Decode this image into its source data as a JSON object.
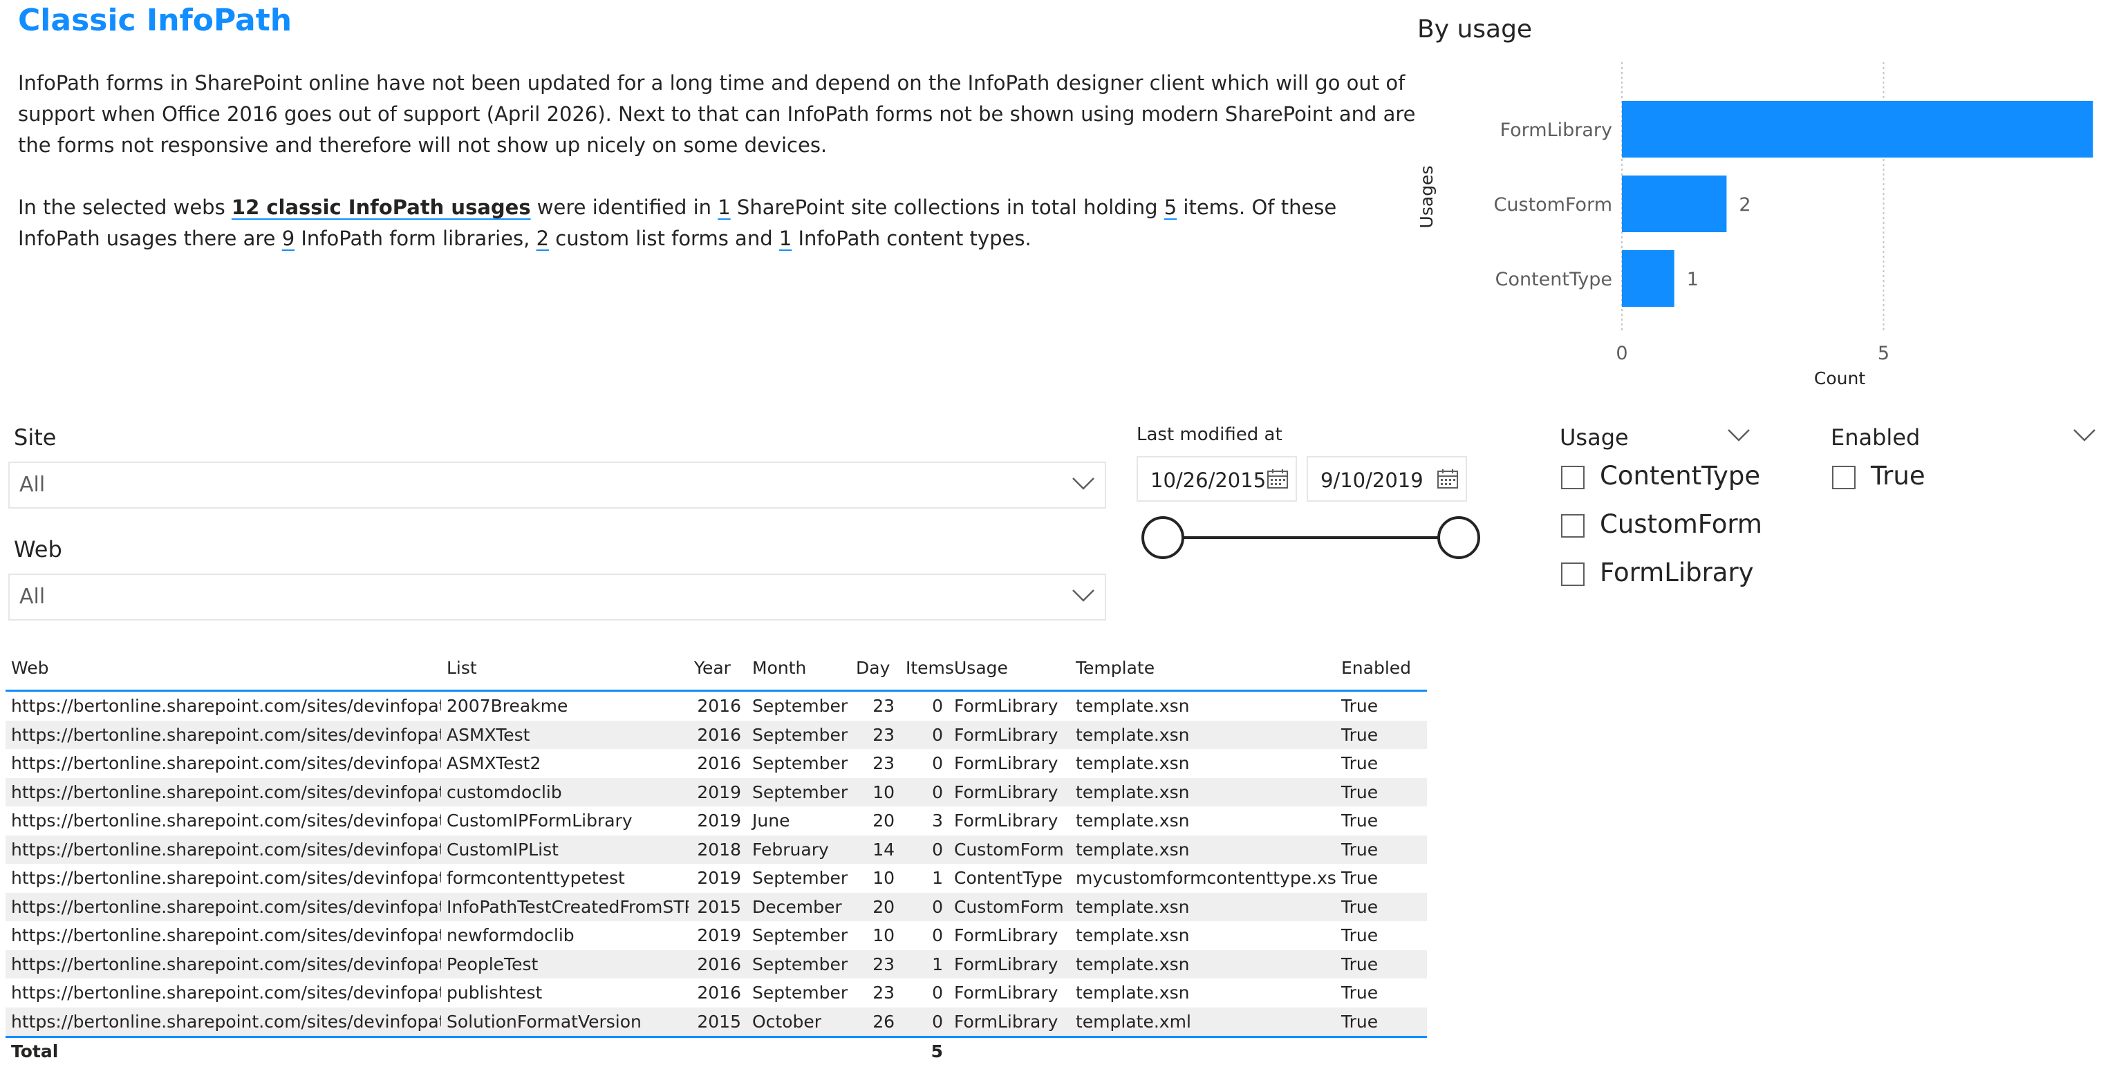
{
  "header": {
    "title": "Classic InfoPath"
  },
  "intro": {
    "paragraph1": "InfoPath forms in SharePoint online have not been updated for a long time and depend on the InfoPath designer client which will go out of support when Office 2016 goes out of support (April 2026). Next to that can InfoPath forms not be shown using modern SharePoint and are the forms not responsive and therefore will not show up nicely on some devices.",
    "p2_a": "In the selected webs ",
    "p2_usages": "12 classic InfoPath usages",
    "p2_b": " were identified in ",
    "p2_sites": "1",
    "p2_c": " SharePoint site collections in total holding ",
    "p2_items": "5",
    "p2_d": " items. Of these InfoPath usages there are ",
    "p2_forms": "9",
    "p2_e": " InfoPath form libraries, ",
    "p2_custom": "2",
    "p2_f": " custom list forms and ",
    "p2_ct": "1",
    "p2_g": " InfoPath content types."
  },
  "chart_data": {
    "type": "bar",
    "orientation": "horizontal",
    "title": "By usage",
    "xlabel": "Count",
    "ylabel": "Usages",
    "categories": [
      "FormLibrary",
      "CustomForm",
      "ContentType"
    ],
    "values": [
      9,
      2,
      1
    ],
    "xlim": [
      0,
      10
    ],
    "xticks": [
      0,
      5,
      10
    ],
    "bar_color": "#118DFF",
    "grid": true
  },
  "filters": {
    "site_label": "Site",
    "site_value": "All",
    "web_label": "Web",
    "web_value": "All",
    "date_label": "Last modified at",
    "date_start": "10/26/2015",
    "date_end": "9/10/2019",
    "usage_label": "Usage",
    "usage_options": [
      "ContentType",
      "CustomForm",
      "FormLibrary"
    ],
    "enabled_label": "Enabled",
    "enabled_options": [
      "True"
    ]
  },
  "table": {
    "columns": [
      "Web",
      "List",
      "Year",
      "Month",
      "Day",
      "Items",
      "Usage",
      "Template",
      "Enabled"
    ],
    "rows": [
      [
        "https://bertonline.sharepoint.com/sites/devinfopath/",
        "2007Breakme",
        "2016",
        "September",
        "23",
        "0",
        "FormLibrary",
        "template.xsn",
        "True"
      ],
      [
        "https://bertonline.sharepoint.com/sites/devinfopath/",
        "ASMXTest",
        "2016",
        "September",
        "23",
        "0",
        "FormLibrary",
        "template.xsn",
        "True"
      ],
      [
        "https://bertonline.sharepoint.com/sites/devinfopath/",
        "ASMXTest2",
        "2016",
        "September",
        "23",
        "0",
        "FormLibrary",
        "template.xsn",
        "True"
      ],
      [
        "https://bertonline.sharepoint.com/sites/devinfopath/",
        "customdoclib",
        "2019",
        "September",
        "10",
        "0",
        "FormLibrary",
        "template.xsn",
        "True"
      ],
      [
        "https://bertonline.sharepoint.com/sites/devinfopath/",
        "CustomIPFormLibrary",
        "2019",
        "June",
        "20",
        "3",
        "FormLibrary",
        "template.xsn",
        "True"
      ],
      [
        "https://bertonline.sharepoint.com/sites/devinfopath/",
        "CustomIPList",
        "2018",
        "February",
        "14",
        "0",
        "CustomForm",
        "template.xsn",
        "True"
      ],
      [
        "https://bertonline.sharepoint.com/sites/devinfopath/",
        "formcontenttypetest",
        "2019",
        "September",
        "10",
        "1",
        "ContentType",
        "mycustomformcontenttype.xsn",
        "True"
      ],
      [
        "https://bertonline.sharepoint.com/sites/devinfopath/",
        "InfoPathTestCreatedFromSTP",
        "2015",
        "December",
        "20",
        "0",
        "CustomForm",
        "template.xsn",
        "True"
      ],
      [
        "https://bertonline.sharepoint.com/sites/devinfopath/",
        "newformdoclib",
        "2019",
        "September",
        "10",
        "0",
        "FormLibrary",
        "template.xsn",
        "True"
      ],
      [
        "https://bertonline.sharepoint.com/sites/devinfopath/",
        "PeopleTest",
        "2016",
        "September",
        "23",
        "1",
        "FormLibrary",
        "template.xsn",
        "True"
      ],
      [
        "https://bertonline.sharepoint.com/sites/devinfopath/",
        "publishtest",
        "2016",
        "September",
        "23",
        "0",
        "FormLibrary",
        "template.xsn",
        "True"
      ],
      [
        "https://bertonline.sharepoint.com/sites/devinfopath/",
        "SolutionFormatVersion",
        "2015",
        "October",
        "26",
        "0",
        "FormLibrary",
        "template.xml",
        "True"
      ]
    ],
    "total_label": "Total",
    "total_items": "5"
  },
  "icons": {
    "dropdown": "chevron-down-icon",
    "date": "calendar-icon",
    "checkbox": "checkbox-icon"
  }
}
